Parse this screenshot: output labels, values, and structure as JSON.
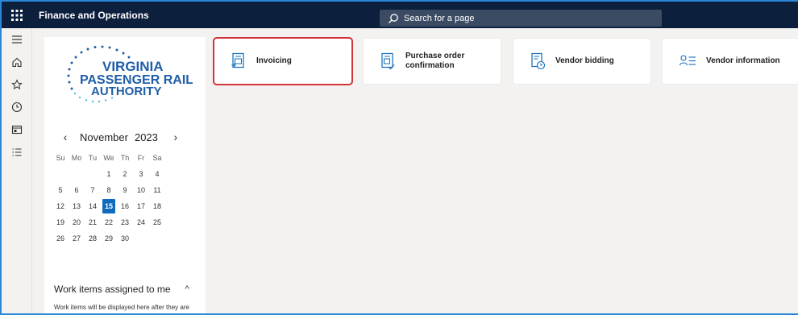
{
  "app": {
    "title": "Finance and Operations"
  },
  "search": {
    "placeholder": "Search for a page"
  },
  "logo": {
    "line1": "VIRGINIA",
    "line2": "PASSENGER RAIL",
    "line3": "AUTHORITY"
  },
  "nav": {
    "icons": [
      "hamburger-icon",
      "home-icon",
      "star-icon",
      "clock-icon",
      "workspace-icon",
      "list-icon"
    ]
  },
  "calendar": {
    "month": "November",
    "year": "2023",
    "prev": "‹",
    "next": "›",
    "weekdays": [
      "Su",
      "Mo",
      "Tu",
      "We",
      "Th",
      "Fr",
      "Sa"
    ],
    "weeks": [
      [
        "",
        "",
        "",
        "1",
        "2",
        "3",
        "4"
      ],
      [
        "5",
        "6",
        "7",
        "8",
        "9",
        "10",
        "11"
      ],
      [
        "12",
        "13",
        "14",
        "15",
        "16",
        "17",
        "18"
      ],
      [
        "19",
        "20",
        "21",
        "22",
        "23",
        "24",
        "25"
      ],
      [
        "26",
        "27",
        "28",
        "29",
        "30",
        "",
        ""
      ]
    ],
    "today": "15"
  },
  "work_items": {
    "title": "Work items assigned to me",
    "caret": "^",
    "empty_text": "Work items will be displayed here after they are assigned to you."
  },
  "tiles": [
    {
      "label": "Invoicing",
      "label2": "",
      "icon": "invoice-icon",
      "highlighted": true
    },
    {
      "label": "Purchase order",
      "label2": "confirmation",
      "icon": "purchase-order-icon",
      "highlighted": false
    },
    {
      "label": "Vendor bidding",
      "label2": "",
      "icon": "vendor-bidding-icon",
      "highlighted": false
    },
    {
      "label": "Vendor information",
      "label2": "",
      "icon": "vendor-information-icon",
      "highlighted": false
    }
  ],
  "colors": {
    "topbar": "#0c1f3d",
    "accent": "#0f6cbd",
    "highlight": "#d13438",
    "logo_blue": "#1f5ea8"
  }
}
